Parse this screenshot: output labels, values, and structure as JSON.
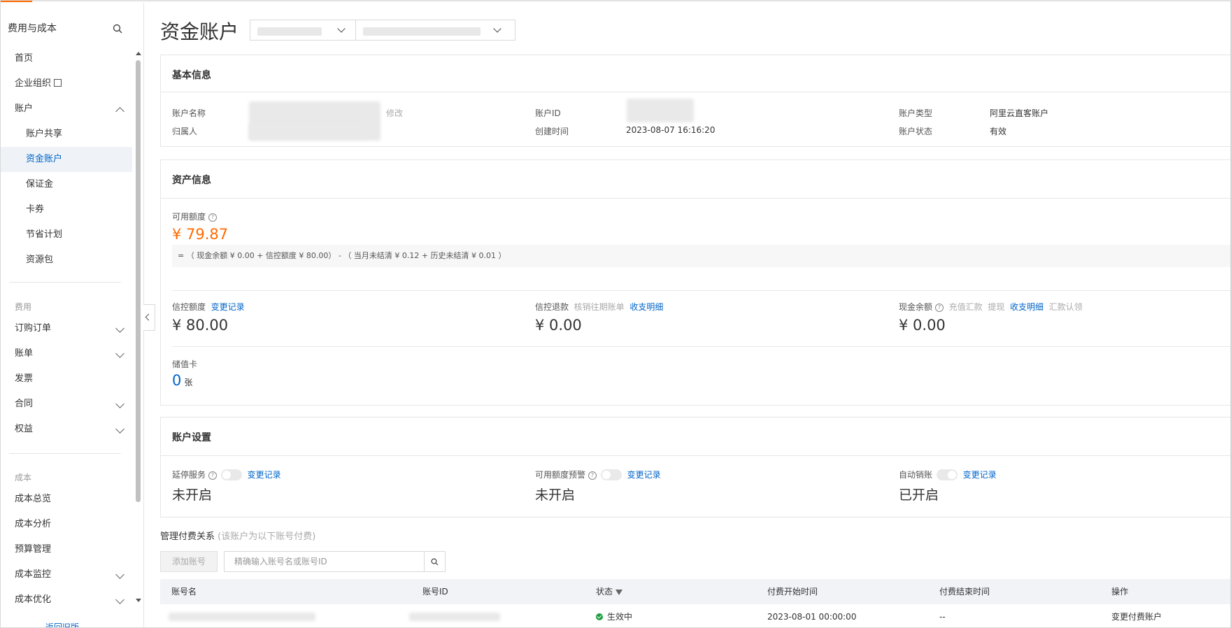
{
  "sidebar": {
    "title": "费用与成本",
    "items": [
      {
        "label": "首页"
      },
      {
        "label": "企业组织"
      },
      {
        "label": "账户"
      },
      {
        "label": "账户共享"
      },
      {
        "label": "资金账户"
      },
      {
        "label": "保证金"
      },
      {
        "label": "卡券"
      },
      {
        "label": "节省计划"
      },
      {
        "label": "资源包"
      }
    ],
    "group_fee": "费用",
    "fee_items": [
      {
        "label": "订购订单"
      },
      {
        "label": "账单"
      },
      {
        "label": "发票"
      },
      {
        "label": "合同"
      },
      {
        "label": "权益"
      }
    ],
    "group_cost": "成本",
    "cost_items": [
      {
        "label": "成本总览"
      },
      {
        "label": "成本分析"
      },
      {
        "label": "预算管理"
      },
      {
        "label": "成本监控"
      },
      {
        "label": "成本优化"
      }
    ],
    "back_old": "返回旧版"
  },
  "header": {
    "title": "资金账户"
  },
  "basic_info": {
    "title": "基本信息",
    "account_name_label": "账户名称",
    "modify": "修改",
    "owner_label": "归属人",
    "account_id_label": "账户ID",
    "created_label": "创建时间",
    "created_value": "2023-08-07 16:16:20",
    "account_type_label": "账户类型",
    "account_type_value": "阿里云直客账户",
    "account_status_label": "账户状态",
    "account_status_value": "有效"
  },
  "asset_info": {
    "title": "资产信息",
    "available_label": "可用额度",
    "available_value": "¥ 79.87",
    "formula": "= （ 现金余额 ¥ 0.00 + 信控额度 ¥ 80.00）  -  （ 当月未结清 ¥ 0.12 + 历史未结清 ¥ 0.01 ）",
    "credit_label": "信控额度",
    "credit_link": "变更记录",
    "credit_value": "¥ 80.00",
    "refund_label": "信控退款",
    "refund_muted": "核销往期账单",
    "refund_link": "收支明细",
    "refund_value": "¥ 0.00",
    "cash_label": "现金余额",
    "cash_muted1": "充值汇款",
    "cash_muted2": "提现",
    "cash_link": "收支明细",
    "cash_muted3": "汇款认领",
    "cash_value": "¥ 0.00",
    "card_label": "储值卡",
    "card_count": "0",
    "card_unit": "张"
  },
  "settings": {
    "title": "账户设置",
    "delay_label": "延停服务",
    "delay_link": "变更记录",
    "delay_status": "未开启",
    "alert_label": "可用额度预警",
    "alert_link": "变更记录",
    "alert_status": "未开启",
    "writeoff_label": "自动销账",
    "writeoff_link": "变更记录",
    "writeoff_status": "已开启"
  },
  "payer": {
    "title": "管理付费关系",
    "subtitle": "(该账户为以下账号付费)",
    "add_button": "添加账号",
    "search_placeholder": "精确输入账号名或账号ID",
    "columns": [
      "账号名",
      "账号ID",
      "状态",
      "付费开始时间",
      "付费结束时间",
      "操作"
    ],
    "rows": [
      {
        "status": "生效中",
        "start": "2023-08-01 00:00:00",
        "end": "--",
        "action": "变更付费账户"
      }
    ]
  }
}
